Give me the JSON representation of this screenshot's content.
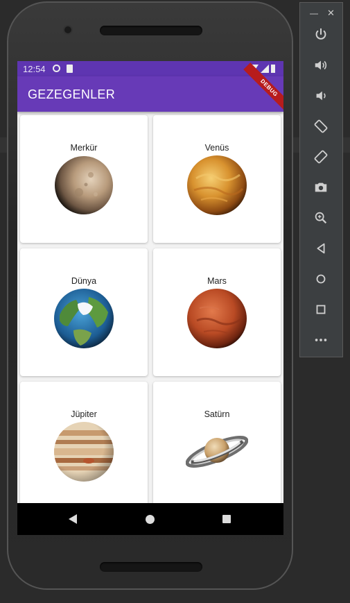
{
  "status_bar": {
    "time": "12:54"
  },
  "app_bar": {
    "title": "GEZEGENLER",
    "debug_banner": "DEBUG"
  },
  "planets": [
    {
      "name": "Merkür",
      "icon": "mercury-image"
    },
    {
      "name": "Venüs",
      "icon": "venus-image"
    },
    {
      "name": "Dünya",
      "icon": "earth-image"
    },
    {
      "name": "Mars",
      "icon": "mars-image"
    },
    {
      "name": "Jüpiter",
      "icon": "jupiter-image"
    },
    {
      "name": "Satürn",
      "icon": "saturn-image"
    }
  ],
  "emulator_controls": [
    "power-icon",
    "volume-up-icon",
    "volume-down-icon",
    "rotate-left-icon",
    "rotate-right-icon",
    "camera-icon",
    "zoom-icon",
    "back-icon",
    "home-icon",
    "overview-icon",
    "more-icon"
  ],
  "colors": {
    "app_bar": "#673ab7",
    "status_bar": "#5e35b1",
    "debug": "#b71c1c"
  }
}
